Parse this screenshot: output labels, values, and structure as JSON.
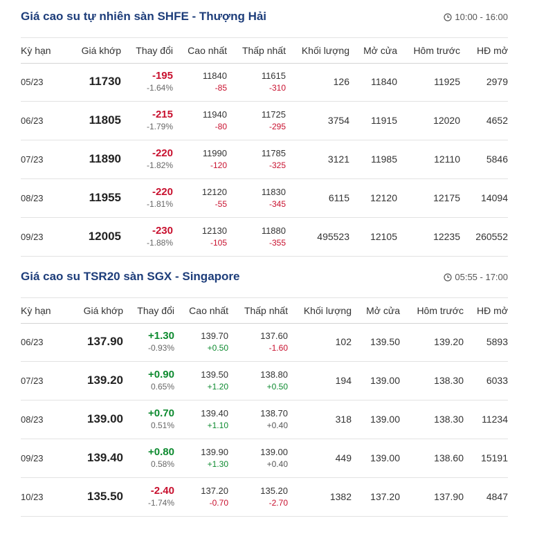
{
  "colors": {
    "title": "#1d3d7a",
    "down": "#c8102e",
    "up": "#0d8a2f",
    "border": "#e2e2e2"
  },
  "columns": [
    "Kỳ hạn",
    "Giá khớp",
    "Thay đổi",
    "Cao nhất",
    "Thấp nhất",
    "Khối lượng",
    "Mở cửa",
    "Hôm trước",
    "HĐ mở"
  ],
  "sections": [
    {
      "title": "Giá cao su tự nhiên sàn SHFE - Thượng Hải",
      "time_icon": "clock-icon",
      "hours": "10:00 - 16:00",
      "rows": [
        {
          "term": "05/23",
          "price": "11730",
          "change": "-195",
          "change_pct": "-1.64%",
          "high": "11840",
          "high_chg": "-85",
          "low": "11615",
          "low_chg": "-310",
          "volume": "126",
          "open": "11840",
          "prev": "11925",
          "oi": "2979"
        },
        {
          "term": "06/23",
          "price": "11805",
          "change": "-215",
          "change_pct": "-1.79%",
          "high": "11940",
          "high_chg": "-80",
          "low": "11725",
          "low_chg": "-295",
          "volume": "3754",
          "open": "11915",
          "prev": "12020",
          "oi": "4652"
        },
        {
          "term": "07/23",
          "price": "11890",
          "change": "-220",
          "change_pct": "-1.82%",
          "high": "11990",
          "high_chg": "-120",
          "low": "11785",
          "low_chg": "-325",
          "volume": "3121",
          "open": "11985",
          "prev": "12110",
          "oi": "5846"
        },
        {
          "term": "08/23",
          "price": "11955",
          "change": "-220",
          "change_pct": "-1.81%",
          "high": "12120",
          "high_chg": "-55",
          "low": "11830",
          "low_chg": "-345",
          "volume": "6115",
          "open": "12120",
          "prev": "12175",
          "oi": "14094"
        },
        {
          "term": "09/23",
          "price": "12005",
          "change": "-230",
          "change_pct": "-1.88%",
          "high": "12130",
          "high_chg": "-105",
          "low": "11880",
          "low_chg": "-355",
          "volume": "495523",
          "open": "12105",
          "prev": "12235",
          "oi": "260552"
        }
      ]
    },
    {
      "title": "Giá cao su TSR20 sàn SGX - Singapore",
      "time_icon": "clock-icon",
      "hours": "05:55 - 17:00",
      "rows": [
        {
          "term": "06/23",
          "price": "137.90",
          "change": "+1.30",
          "change_pct": "-0.93%",
          "high": "139.70",
          "high_chg": "+0.50",
          "low": "137.60",
          "low_chg": "-1.60",
          "volume": "102",
          "open": "139.50",
          "prev": "139.20",
          "oi": "5893"
        },
        {
          "term": "07/23",
          "price": "139.20",
          "change": "+0.90",
          "change_pct": "0.65%",
          "high": "139.50",
          "high_chg": "+1.20",
          "low": "138.80",
          "low_chg": "+0.50",
          "volume": "194",
          "open": "139.00",
          "prev": "138.30",
          "oi": "6033"
        },
        {
          "term": "08/23",
          "price": "139.00",
          "change": "+0.70",
          "change_pct": "0.51%",
          "high": "139.40",
          "high_chg": "+1.10",
          "low": "138.70",
          "low_chg": "+0.40",
          "volume": "318",
          "open": "139.00",
          "prev": "138.30",
          "oi": "11234"
        },
        {
          "term": "09/23",
          "price": "139.40",
          "change": "+0.80",
          "change_pct": "0.58%",
          "high": "139.90",
          "high_chg": "+1.30",
          "low": "139.00",
          "low_chg": "+0.40",
          "volume": "449",
          "open": "139.00",
          "prev": "138.60",
          "oi": "15191"
        },
        {
          "term": "10/23",
          "price": "135.50",
          "change": "-2.40",
          "change_pct": "-1.74%",
          "high": "137.20",
          "high_chg": "-0.70",
          "low": "135.20",
          "low_chg": "-2.70",
          "volume": "1382",
          "open": "137.20",
          "prev": "137.90",
          "oi": "4847"
        }
      ]
    }
  ]
}
